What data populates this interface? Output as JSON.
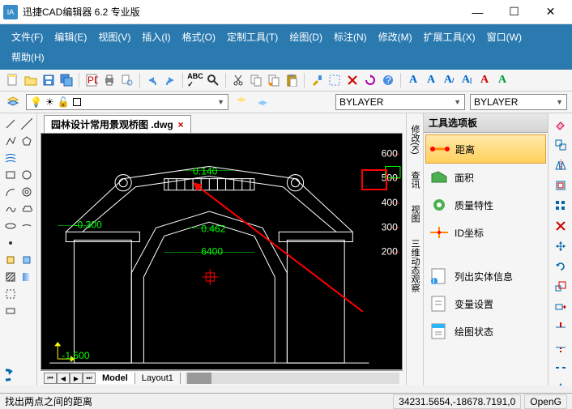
{
  "title": "迅捷CAD编辑器 6.2 专业版",
  "app_icon": "IA",
  "menu": [
    "文件(F)",
    "编辑(E)",
    "视图(V)",
    "插入(I)",
    "格式(O)",
    "定制工具(T)",
    "绘图(D)",
    "标注(N)",
    "修改(M)",
    "扩展工具(X)",
    "窗口(W)",
    "帮助(H)"
  ],
  "layer": {
    "bylayer1": "BYLAYER",
    "bylayer2": "BYLAYER"
  },
  "doc_tab": "园林设计常用景观桥图 .dwg",
  "sheet_tabs": {
    "model": "Model",
    "layout": "Layout1"
  },
  "palette": {
    "header": "工具选项板",
    "items": [
      {
        "label": "距离",
        "icon": "distance",
        "active": true
      },
      {
        "label": "面积",
        "icon": "area"
      },
      {
        "label": "质量特性",
        "icon": "mass"
      },
      {
        "label": "ID坐标",
        "icon": "idpoint"
      },
      {
        "label": "列出实体信息",
        "icon": "listinfo"
      },
      {
        "label": "变量设置",
        "icon": "varset"
      },
      {
        "label": "绘图状态",
        "icon": "drawstate"
      }
    ]
  },
  "side_tabs": [
    "修改(K)",
    "查讯",
    "视图",
    "三维动态观察"
  ],
  "status": {
    "left": "找出两点之间的距离",
    "coords": "34231.5654,-18678.7191,0",
    "mode": "OpenG"
  },
  "dims": {
    "a": "0.140",
    "b": "-0.300",
    "c": "0.462",
    "d": "6400",
    "e": "-1.500"
  },
  "ruler": [
    "600",
    "500",
    "400",
    "300",
    "200"
  ],
  "win": {
    "min": "—",
    "max": "☐",
    "close": "✕"
  }
}
